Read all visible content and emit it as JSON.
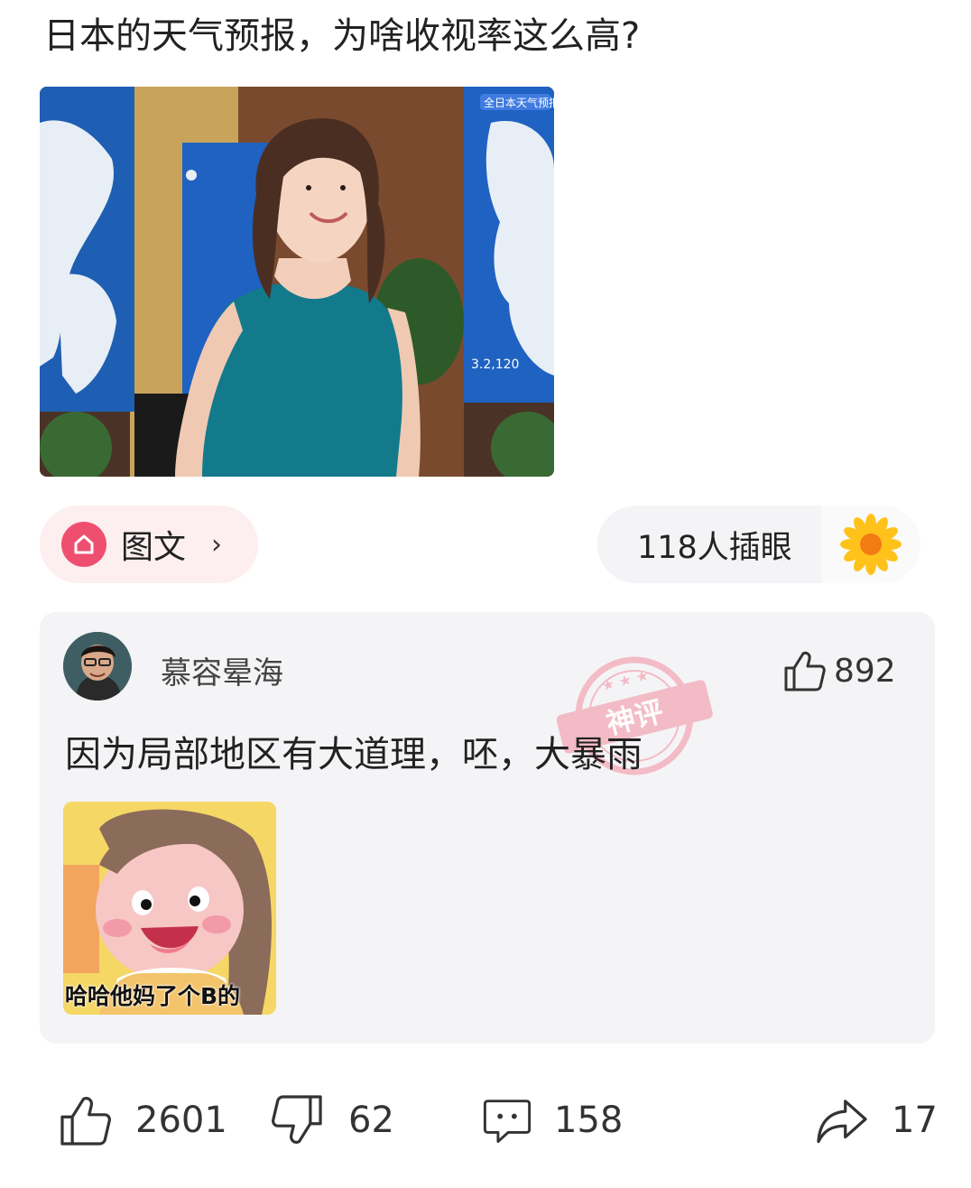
{
  "post": {
    "title": "日本的天气预报，为啥收视率这么高?",
    "image": "weather-presenter-photo"
  },
  "tag": {
    "icon": "home-icon",
    "label": "图文",
    "chevron": "›"
  },
  "viewers": {
    "label": "118人插眼",
    "icon": "sunflower-icon"
  },
  "comment": {
    "username": "慕容晕海",
    "likes": "892",
    "text": "因为局部地区有大道理，呸，大暴雨",
    "stamp_text": "神评",
    "sticker_caption": "哈哈他妈了个B的"
  },
  "actions": {
    "likes": "2601",
    "dislikes": "62",
    "comments": "158",
    "shares": "17"
  },
  "colors": {
    "accent": "#ef4f6f",
    "tag_bg": "#fdeef0",
    "card_bg": "#f4f4f6",
    "stamp": "#f3a8b6"
  }
}
